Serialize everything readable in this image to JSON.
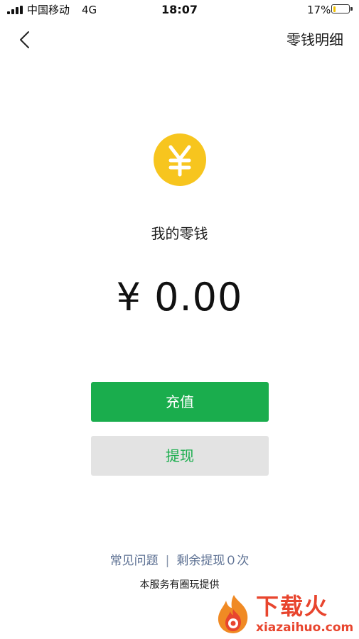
{
  "status_bar": {
    "carrier": "中国移动",
    "network": "4G",
    "time": "18:07",
    "battery_text": "17%",
    "battery_level": 0.17
  },
  "nav": {
    "detail_link": "零钱明细"
  },
  "balance": {
    "label": "我的零钱",
    "amount": "¥ 0.00"
  },
  "actions": {
    "recharge": "充值",
    "withdraw": "提现"
  },
  "footer": {
    "faq": "常见问题",
    "separator": "|",
    "remaining_withdrawals": "剩余提现０次",
    "provider": "本服务有圈玩提供"
  },
  "watermark": {
    "title": "下载火",
    "domain": "xiazaihuo.com"
  },
  "colors": {
    "primary_green": "#1aad4d",
    "coin_yellow": "#f7c51e",
    "secondary_gray": "#e3e3e3",
    "link_blue": "#5b6f92",
    "watermark_red": "#e8452e"
  }
}
